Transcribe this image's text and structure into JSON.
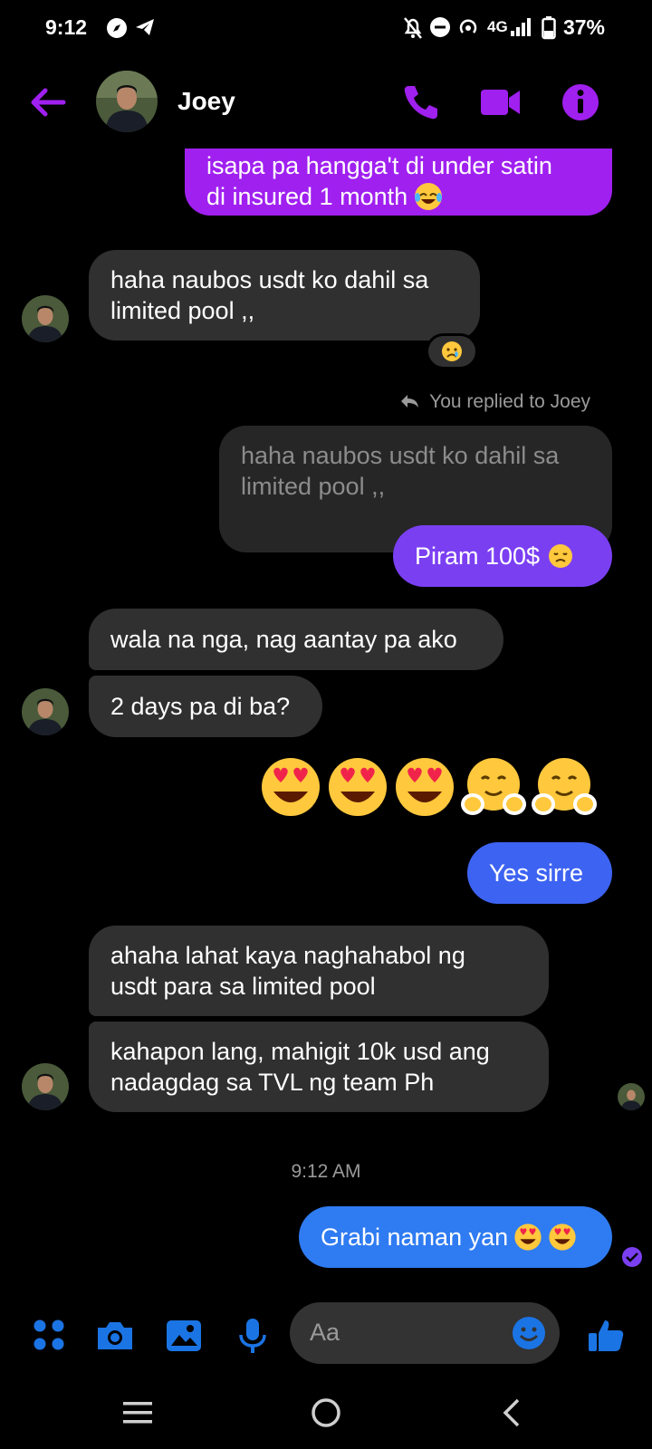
{
  "status": {
    "time": "9:12",
    "network": "4G",
    "battery": "37%"
  },
  "header": {
    "contact_name": "Joey"
  },
  "messages": {
    "m1": {
      "line1": "isapa pa hangga't di under satin",
      "line2": "di insured 1 month"
    },
    "m2": {
      "line1": "haha naubos usdt ko dahil sa",
      "line2": "limited pool ,,"
    },
    "replied_label": "You replied to Joey",
    "quoted": {
      "line1": "haha naubos usdt ko dahil sa",
      "line2": "limited pool ,,"
    },
    "m3": "Piram 100$",
    "m4": "wala na nga, nag aantay pa ako",
    "m5": "2 days pa di ba?",
    "m6": "Yes sirre",
    "m7": {
      "line1": "ahaha lahat kaya naghahabol ng",
      "line2": "usdt para sa limited pool"
    },
    "m8": {
      "line1": "kahapon lang, mahigit 10k usd ang",
      "line2": "nadagdag sa TVL ng team Ph"
    },
    "timestamp": "9:12 AM",
    "m9": "Grabi naman yan"
  },
  "composer": {
    "placeholder": "Aa"
  },
  "colors": {
    "accent": "#a020f0",
    "composer_blue": "#1b74e4"
  },
  "icons": [
    "back-arrow-icon",
    "phone-icon",
    "video-icon",
    "info-icon",
    "apps-icon",
    "camera-icon",
    "gallery-icon",
    "mic-icon",
    "emoji-icon",
    "thumbs-up-icon",
    "menu-icon",
    "home-icon",
    "back-nav-icon"
  ]
}
